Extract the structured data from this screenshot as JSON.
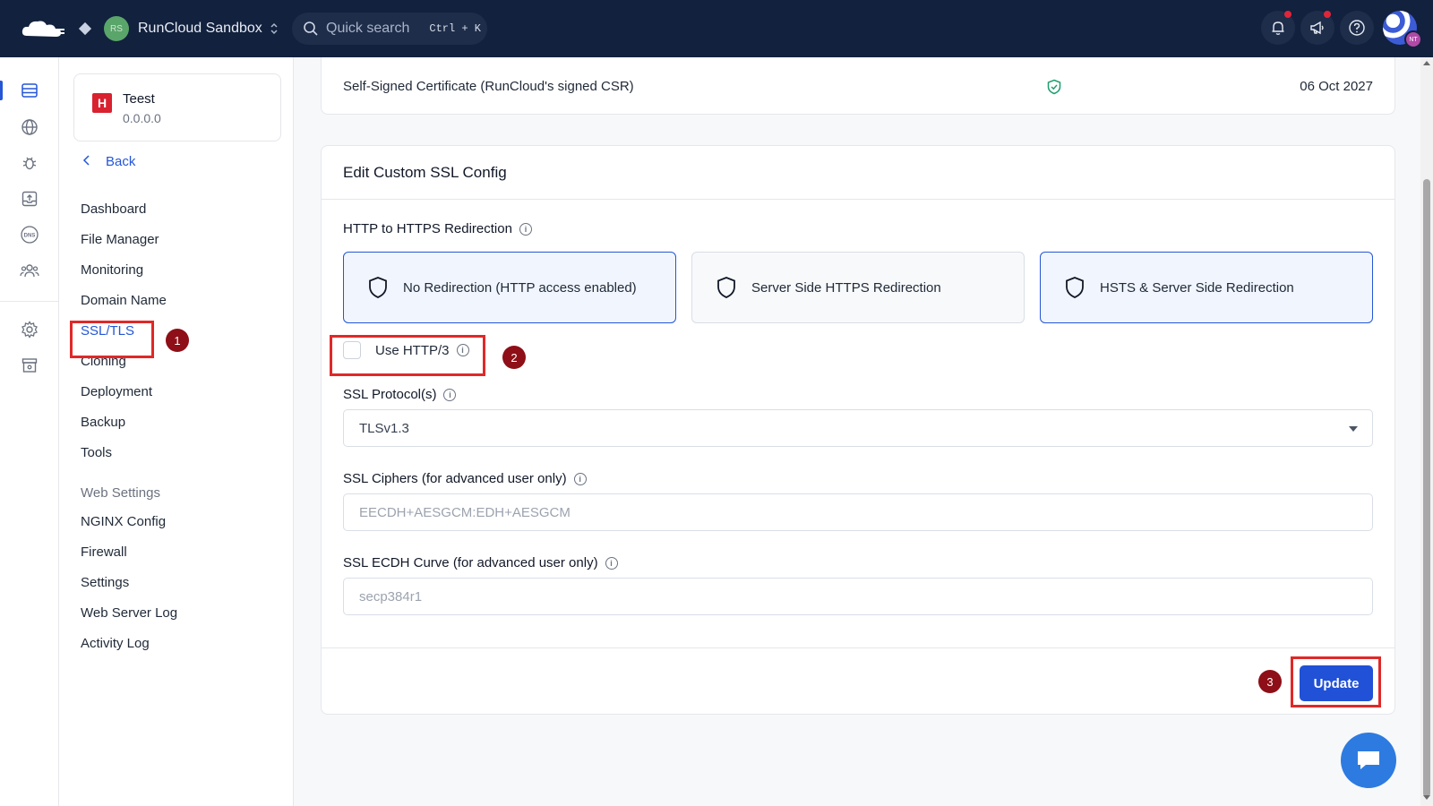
{
  "topbar": {
    "workspace_avatar": "RS",
    "workspace_name": "RunCloud Sandbox",
    "search_placeholder": "Quick search",
    "search_shortcut": "Ctrl + K",
    "user_initials": "NT"
  },
  "app": {
    "logo_letter": "H",
    "name": "Teest",
    "ip": "0.0.0.0"
  },
  "sidebar": {
    "back_label": "Back",
    "items": [
      {
        "label": "Dashboard"
      },
      {
        "label": "File Manager"
      },
      {
        "label": "Monitoring"
      },
      {
        "label": "Domain Name"
      },
      {
        "label": "SSL/TLS"
      },
      {
        "label": "Cloning"
      },
      {
        "label": "Deployment"
      },
      {
        "label": "Backup"
      },
      {
        "label": "Tools"
      }
    ],
    "section_title": "Web Settings",
    "section_items": [
      {
        "label": "NGINX Config"
      },
      {
        "label": "Firewall"
      },
      {
        "label": "Settings"
      },
      {
        "label": "Web Server Log"
      },
      {
        "label": "Activity Log"
      }
    ]
  },
  "certificate": {
    "name": "Self-Signed Certificate (RunCloud's signed CSR)",
    "expiry": "06 Oct 2027"
  },
  "ssl_config": {
    "title": "Edit Custom SSL Config",
    "redirection_label": "HTTP to HTTPS Redirection",
    "options": [
      {
        "label": "No Redirection (HTTP access enabled)",
        "selected": true
      },
      {
        "label": "Server Side HTTPS Redirection",
        "selected": false
      },
      {
        "label": "HSTS & Server Side Redirection",
        "selected": true
      }
    ],
    "http3_label": "Use HTTP/3",
    "http3_checked": false,
    "protocol_label": "SSL Protocol(s)",
    "protocol_value": "TLSv1.3",
    "ciphers_label": "SSL Ciphers (for advanced user only)",
    "ciphers_placeholder": "EECDH+AESGCM:EDH+AESGCM",
    "ecdh_label": "SSL ECDH Curve (for advanced user only)",
    "ecdh_placeholder": "secp384r1",
    "update_label": "Update"
  },
  "annotations": {
    "step1": "1",
    "step2": "2",
    "step3": "3",
    "highlight_color": "#e02828",
    "badge_color": "#8e0f17"
  },
  "colors": {
    "topbar": "#12213d",
    "accent": "#2456d6",
    "button": "#2151d6"
  }
}
